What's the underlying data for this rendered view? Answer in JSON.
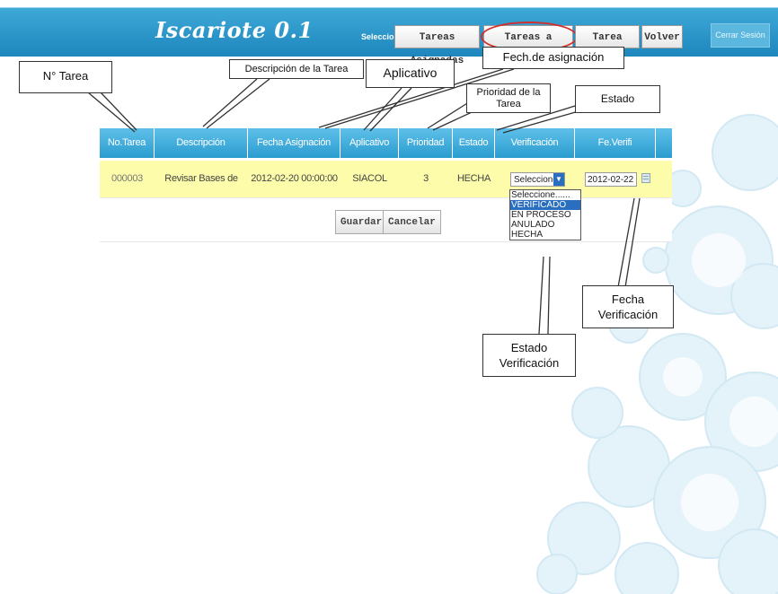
{
  "header": {
    "logo": "Iscariote 0.1",
    "select_label": "Seleccione:",
    "nav": [
      "Tareas Asignadas",
      "Tareas a Verificar",
      "Tarea Nueva",
      "Volver"
    ],
    "close": "Cerrar Sesión"
  },
  "table": {
    "headers": [
      "No.Tarea",
      "Descripción",
      "Fecha Asignación",
      "Aplicativo",
      "Prioridad",
      "Estado",
      "Verificación",
      "Fe.Verifi"
    ],
    "row": {
      "no": "000003",
      "descripcion": "Revisar Bases de Datos",
      "fecha": "2012-02-20 00:00:00",
      "aplicativo": "SIACOL WEB",
      "prioridad": "3",
      "estado": "HECHA",
      "verificacion": "Seleccione.",
      "fe_verifi": "2012-02-22"
    }
  },
  "actions": {
    "save": "Guardar",
    "cancel": "Cancelar"
  },
  "dropdown": {
    "options": [
      "Seleccione......",
      "VERIFICADO",
      "EN PROCESO",
      "ANULADO",
      "HECHA"
    ],
    "highlighted": "VERIFICADO"
  },
  "callouts": {
    "n_tarea": "N° Tarea",
    "descripcion": "Descripción  de la Tarea",
    "aplicativo": "Aplicativo",
    "fecha_asignacion": "Fech.de asignación",
    "prioridad": "Prioridad de la Tarea",
    "estado": "Estado",
    "fecha_verificacion": "Fecha Verificación",
    "estado_verificacion": "Estado Verificación"
  },
  "colors": {
    "header": "#1d86bd",
    "table_header": "#2b9ccf",
    "row_bg": "#fdfcaa",
    "highlight": "#2a6fbf",
    "circle": "#d12e2e"
  }
}
